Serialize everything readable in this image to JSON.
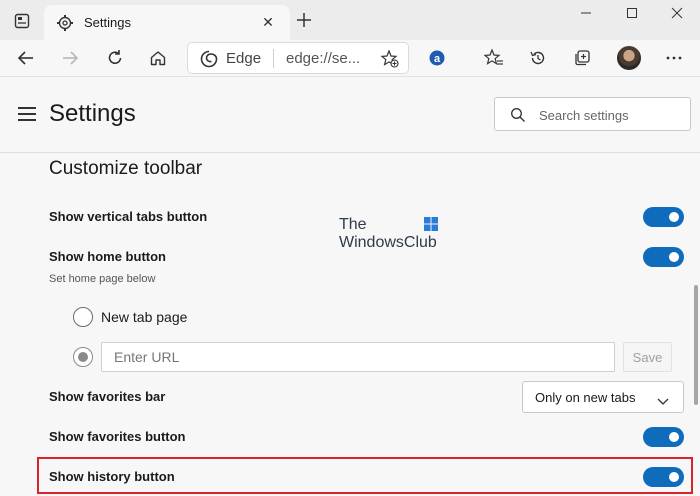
{
  "window": {
    "tab_title": "Settings",
    "colors": {
      "accent": "#0f6cbd",
      "highlight": "#d9232d",
      "background": "#f7f7f7"
    }
  },
  "toolbar": {
    "omnibox_site": "Edge",
    "omnibox_url": "edge://se..."
  },
  "header": {
    "title": "Settings",
    "search_placeholder": "Search settings"
  },
  "content": {
    "section_title": "Customize toolbar",
    "rows": {
      "vertical_tabs": {
        "label": "Show vertical tabs button",
        "enabled": true
      },
      "home": {
        "label": "Show home button",
        "sublabel": "Set home page below",
        "enabled": true
      },
      "favorites_bar": {
        "label": "Show favorites bar",
        "value": "Only on new tabs"
      },
      "favorites_button": {
        "label": "Show favorites button",
        "enabled": true
      },
      "history_button": {
        "label": "Show history button",
        "enabled": true
      }
    },
    "home_options": {
      "new_tab_label": "New tab page",
      "url_placeholder": "Enter URL",
      "save_label": "Save"
    }
  },
  "watermark": {
    "line1": "The",
    "line2": "WindowsClub"
  }
}
